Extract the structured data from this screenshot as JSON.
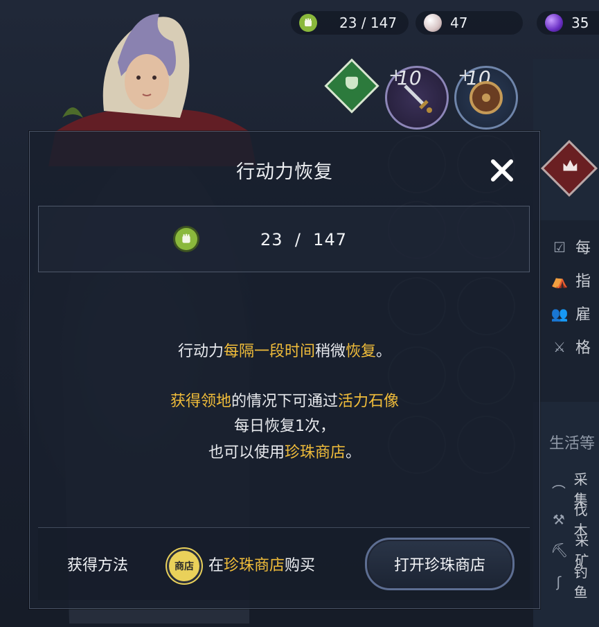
{
  "top_bar": {
    "stamina": {
      "icon": "fist-icon",
      "value": "23 / 147",
      "color": "#8ab83c"
    },
    "pearls": {
      "icon": "pearl-icon",
      "value": "47"
    },
    "gems": {
      "icon": "purple-gem-icon",
      "value": "35",
      "color": "#7a3fd6"
    }
  },
  "equipment": [
    {
      "icon": "sword-icon",
      "plus": "+",
      "level": "10"
    },
    {
      "icon": "shield-icon",
      "plus": "+",
      "level": "10"
    }
  ],
  "side_panel": {
    "rows": [
      {
        "icon": "checklist-icon",
        "label": "每"
      },
      {
        "icon": "tent-icon",
        "label": "指"
      },
      {
        "icon": "people-icon",
        "label": "雇"
      },
      {
        "icon": "crossed-swords-icon",
        "label": "格"
      }
    ],
    "section_title": "生活等",
    "life_rows": [
      {
        "icon": "sickle-icon",
        "label": "采集"
      },
      {
        "icon": "axe-icon",
        "label": "伐木"
      },
      {
        "icon": "pickaxe-icon",
        "label": "采矿"
      },
      {
        "icon": "fishing-icon",
        "label": "钓鱼"
      }
    ]
  },
  "modal": {
    "title": "行动力恢复",
    "counter": {
      "icon": "fist-icon",
      "current": "23",
      "separator": "/",
      "max": "147"
    },
    "description": {
      "line1": {
        "a": "行动力",
        "b": "每隔一段时间",
        "c": "稍微",
        "d": "恢复",
        "e": "。"
      },
      "line2": {
        "a": "获得领地",
        "b": "的情况下可通过",
        "c": "活力石像"
      },
      "line3": "每日恢复1次，",
      "line4": {
        "a": "也可以使用",
        "b": "珍珠商店",
        "c": "。"
      }
    },
    "footer": {
      "label": "获得方法",
      "badge": "商店",
      "source": {
        "a": "在",
        "b": "珍珠商店",
        "c": "购买"
      },
      "button": "打开珍珠商店"
    }
  },
  "colors": {
    "highlight": "#f1bd3a",
    "accent_green": "#8ab83c"
  }
}
